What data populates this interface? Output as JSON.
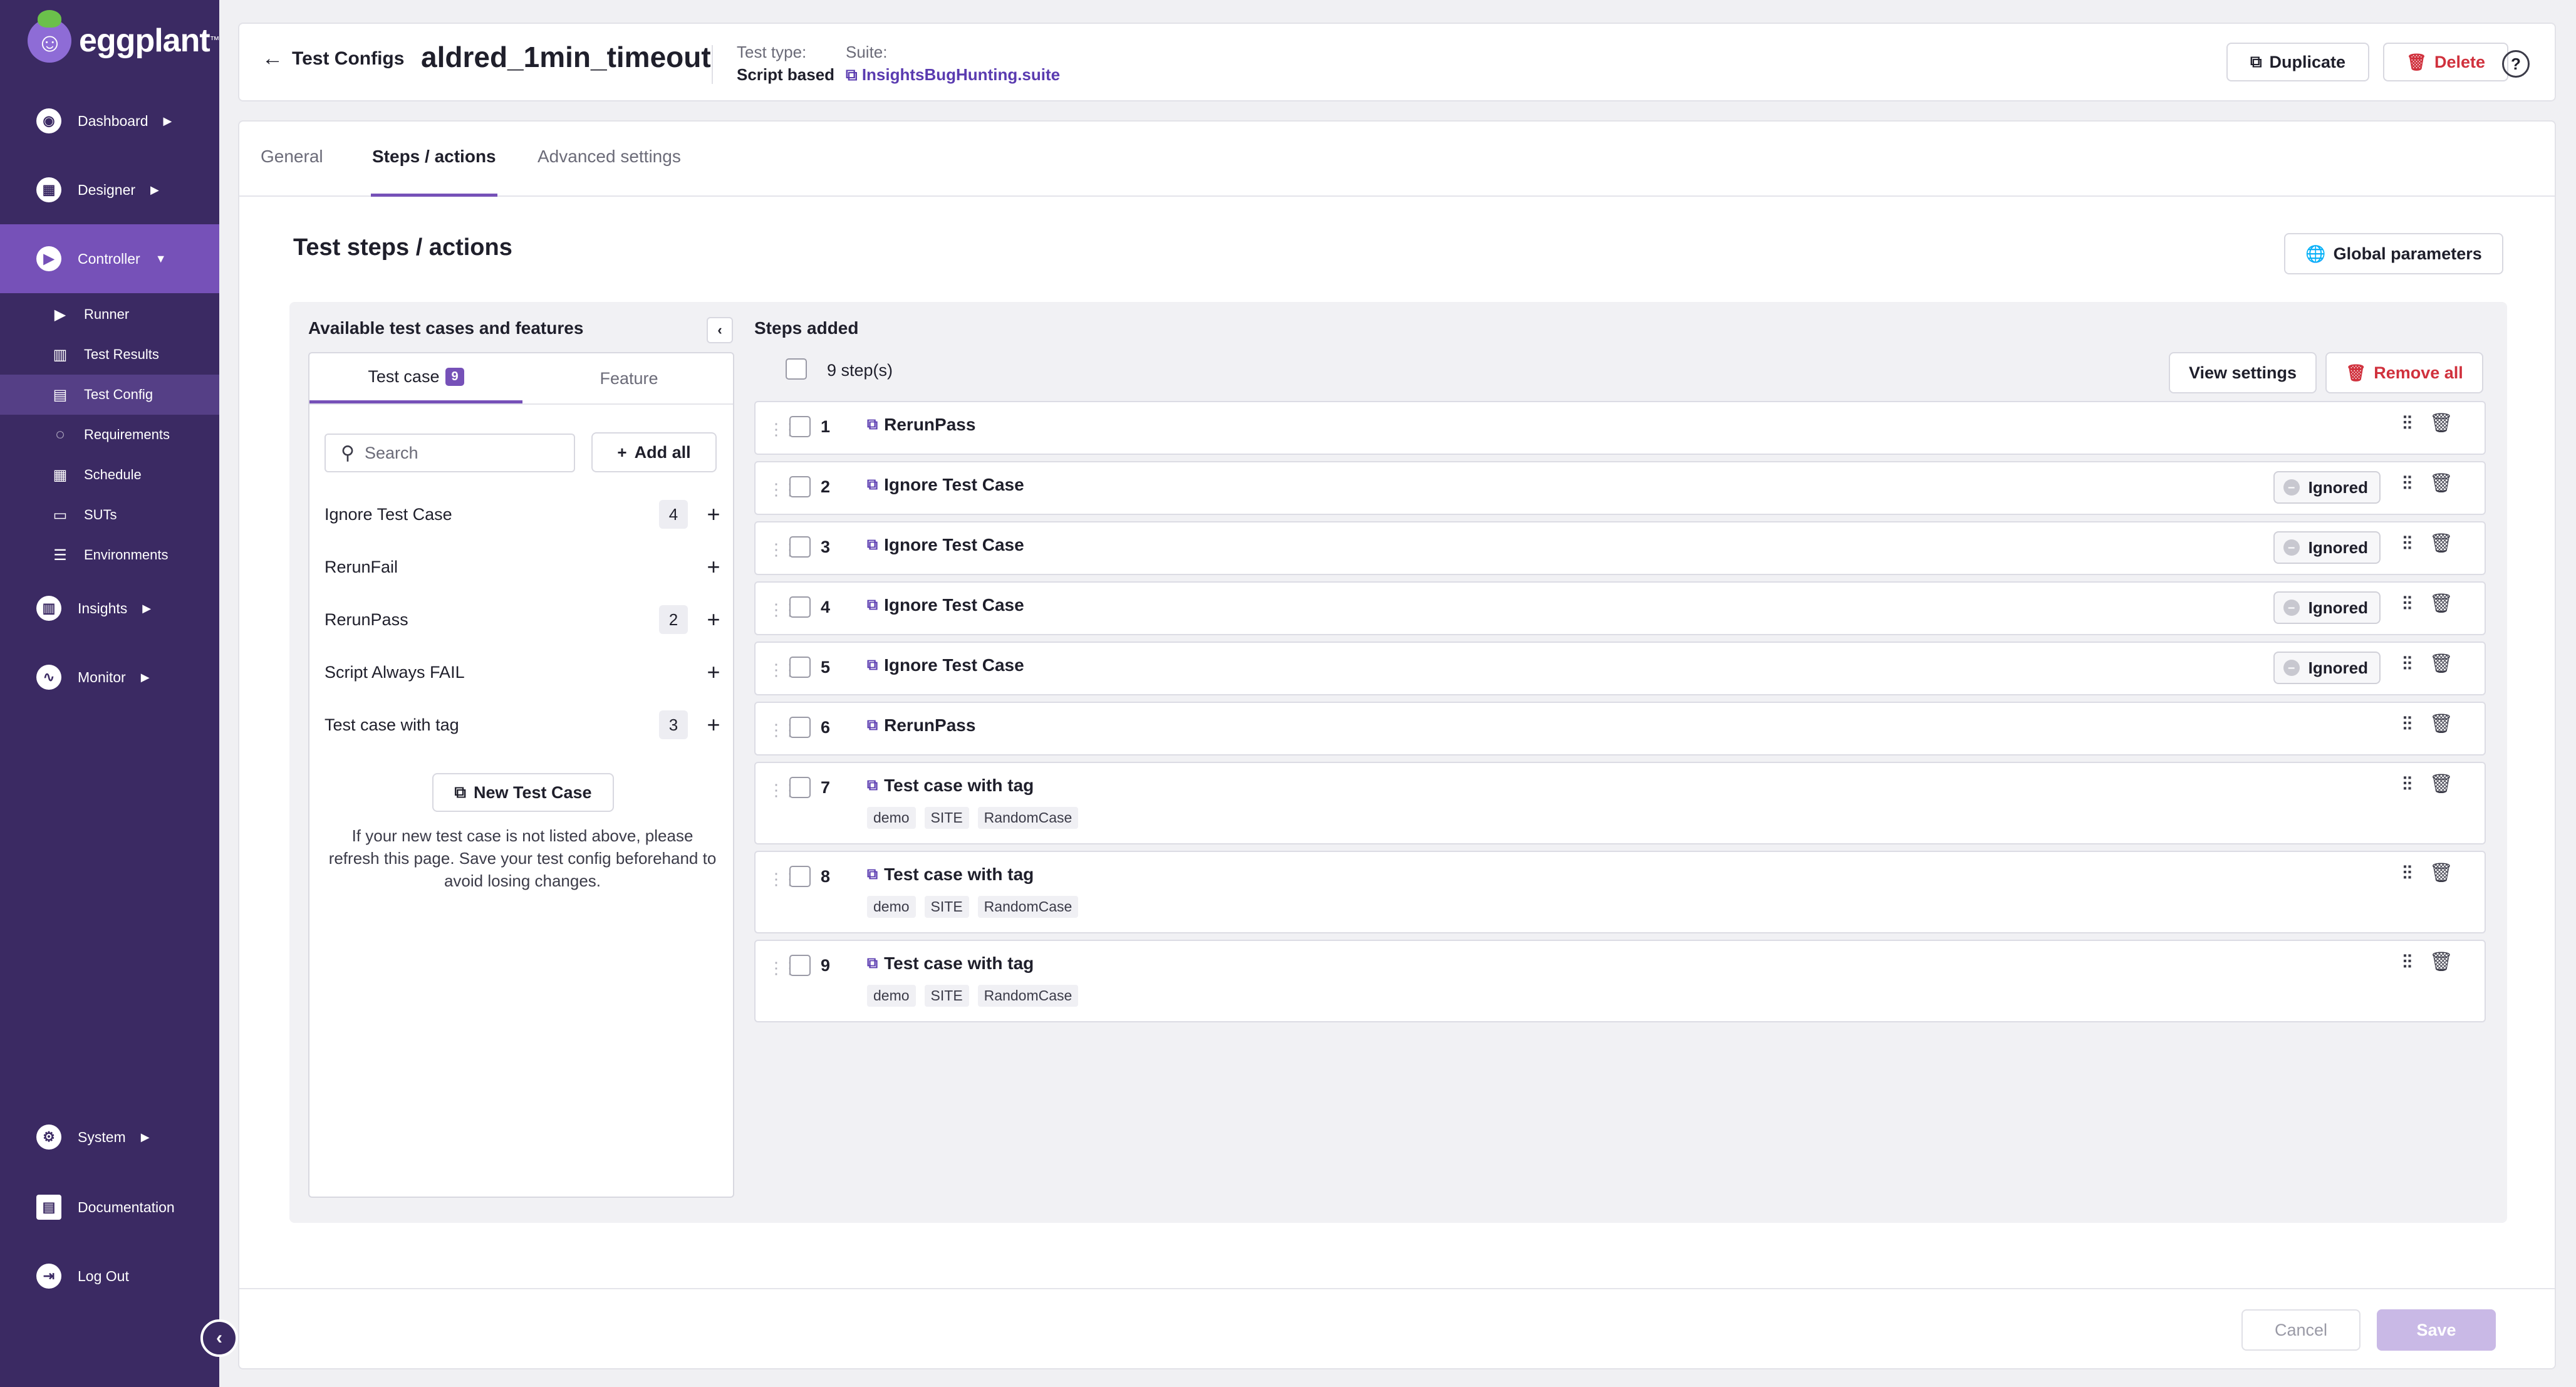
{
  "brand": {
    "name": "eggplant",
    "tm": "™"
  },
  "sidebar": {
    "items": [
      {
        "label": "Dashboard",
        "icon": "dashboard-icon"
      },
      {
        "label": "Designer",
        "icon": "designer-icon"
      },
      {
        "label": "Controller",
        "icon": "controller-icon"
      },
      {
        "label": "Insights",
        "icon": "insights-icon"
      },
      {
        "label": "Monitor",
        "icon": "monitor-icon"
      },
      {
        "label": "System",
        "icon": "system-icon"
      },
      {
        "label": "Documentation",
        "icon": "documentation-icon"
      },
      {
        "label": "Log Out",
        "icon": "logout-icon"
      }
    ],
    "controller_sub": [
      {
        "label": "Runner"
      },
      {
        "label": "Test Results"
      },
      {
        "label": "Test Config"
      },
      {
        "label": "Requirements"
      },
      {
        "label": "Schedule"
      },
      {
        "label": "SUTs"
      },
      {
        "label": "Environments"
      }
    ]
  },
  "header": {
    "back_label": "Test Configs",
    "config_name": "aldred_1min_timeout",
    "test_type_label": "Test type:",
    "test_type_value": "Script based",
    "suite_label": "Suite:",
    "suite_value": "InsightsBugHunting.suite",
    "duplicate_label": "Duplicate",
    "delete_label": "Delete"
  },
  "tabs": [
    {
      "label": "General"
    },
    {
      "label": "Steps / actions"
    },
    {
      "label": "Advanced settings"
    }
  ],
  "section_title": "Test steps / actions",
  "global_params_label": "Global parameters",
  "available": {
    "title": "Available test cases and features",
    "tab_test_case": "Test case",
    "tab_test_case_count": "9",
    "tab_feature": "Feature",
    "search_placeholder": "Search",
    "add_all_label": "Add all",
    "items": [
      {
        "name": "Ignore Test Case",
        "count": "4"
      },
      {
        "name": "RerunFail",
        "count": ""
      },
      {
        "name": "RerunPass",
        "count": "2"
      },
      {
        "name": "Script Always FAIL",
        "count": ""
      },
      {
        "name": "Test case with tag",
        "count": "3"
      }
    ],
    "new_test_case_label": "New Test Case",
    "note": "If your new test case is not listed above, please refresh this page. Save your test config beforehand to avoid losing changes."
  },
  "steps": {
    "title": "Steps added",
    "count_label": "9 step(s)",
    "view_settings_label": "View settings",
    "remove_all_label": "Remove all",
    "ignored_label": "Ignored",
    "items": [
      {
        "num": "1",
        "name": "RerunPass",
        "ignored": false,
        "tags": []
      },
      {
        "num": "2",
        "name": "Ignore Test Case",
        "ignored": true,
        "tags": []
      },
      {
        "num": "3",
        "name": "Ignore Test Case",
        "ignored": true,
        "tags": []
      },
      {
        "num": "4",
        "name": "Ignore Test Case",
        "ignored": true,
        "tags": []
      },
      {
        "num": "5",
        "name": "Ignore Test Case",
        "ignored": true,
        "tags": []
      },
      {
        "num": "6",
        "name": "RerunPass",
        "ignored": false,
        "tags": []
      },
      {
        "num": "7",
        "name": "Test case with tag",
        "ignored": false,
        "tags": [
          "demo",
          "SITE",
          "RandomCase"
        ]
      },
      {
        "num": "8",
        "name": "Test case with tag",
        "ignored": false,
        "tags": [
          "demo",
          "SITE",
          "RandomCase"
        ]
      },
      {
        "num": "9",
        "name": "Test case with tag",
        "ignored": false,
        "tags": [
          "demo",
          "SITE",
          "RandomCase"
        ]
      }
    ]
  },
  "footer": {
    "cancel_label": "Cancel",
    "save_label": "Save"
  },
  "colors": {
    "sidebar": "#3b2a63",
    "accent": "#7651b8",
    "danger": "#d0313d",
    "link": "#5a3bb0"
  }
}
